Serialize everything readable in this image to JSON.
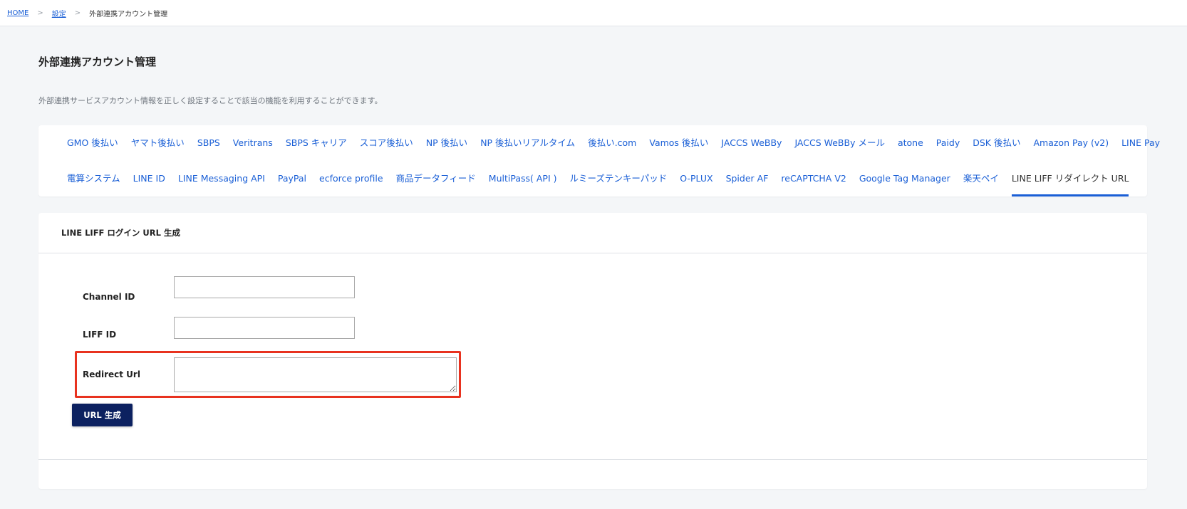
{
  "breadcrumb": {
    "home": "HOME",
    "separator": ">",
    "settings": "設定",
    "current": "外部連携アカウント管理"
  },
  "page": {
    "title": "外部連携アカウント管理",
    "description": "外部連携サービスアカウント情報を正しく設定することで該当の機能を利用することができます。"
  },
  "tabs": {
    "row1": [
      "GMO 後払い",
      "ヤマト後払い",
      "SBPS",
      "Veritrans",
      "SBPS キャリア",
      "スコア後払い",
      "NP 後払い",
      "NP 後払いリアルタイム",
      "後払い.com",
      "Vamos 後払い",
      "JACCS WeBBy",
      "JACCS WeBBy メール",
      "atone",
      "Paidy",
      "DSK 後払い",
      "Amazon Pay (v2)",
      "LINE Pay"
    ],
    "row2": [
      "電算システム",
      "LINE ID",
      "LINE Messaging API",
      "PayPal",
      "ecforce profile",
      "商品データフィード",
      "MultiPass( API )",
      "ルミーズテンキーパッド",
      "O-PLUX",
      "Spider AF",
      "reCAPTCHA V2",
      "Google Tag Manager",
      "楽天ペイ"
    ],
    "active": "LINE LIFF リダイレクト URL"
  },
  "form": {
    "header": "LINE LIFF ログイン URL 生成",
    "channel_id_label": "Channel ID",
    "channel_id_value": "",
    "liff_id_label": "LIFF ID",
    "liff_id_value": "",
    "redirect_url_label": "Redirect Url",
    "redirect_url_value": "",
    "submit_label": "URL 生成"
  },
  "colors": {
    "accent": "#1a5fd6",
    "button": "#0c2160",
    "highlight": "#e8321f"
  }
}
